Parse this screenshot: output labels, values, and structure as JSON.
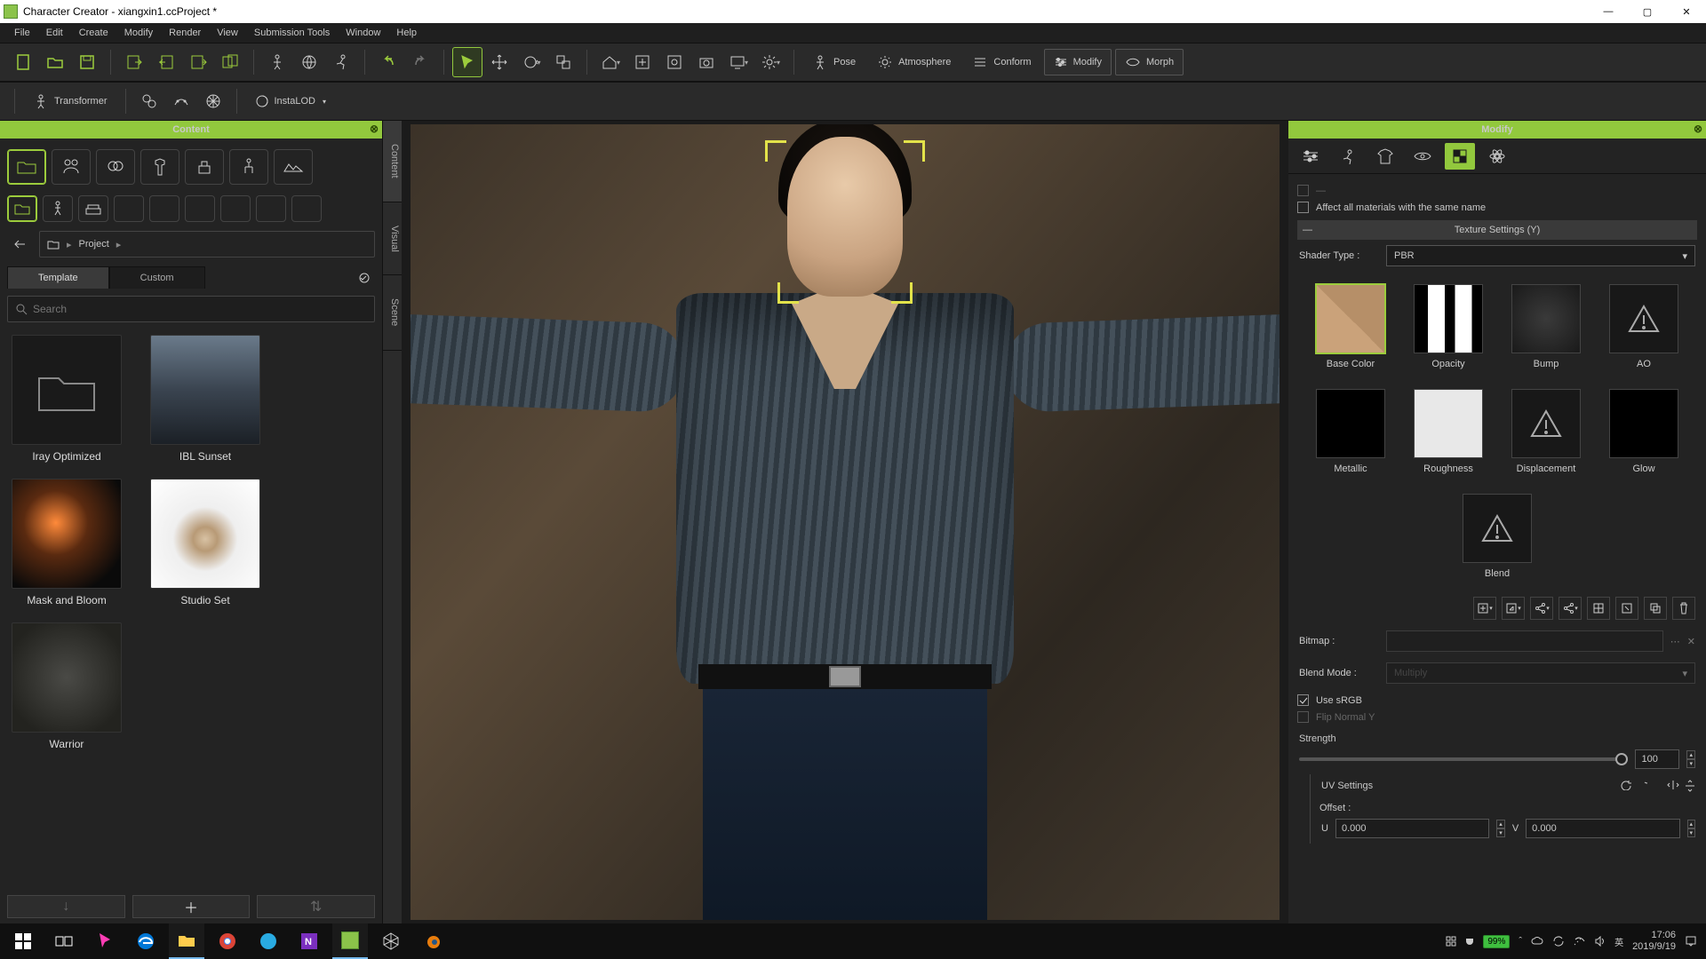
{
  "title": "Character Creator - xiangxin1.ccProject *",
  "menu": [
    "File",
    "Edit",
    "Create",
    "Modify",
    "Render",
    "View",
    "Submission Tools",
    "Window",
    "Help"
  ],
  "toolbar1_labels": {
    "pose": "Pose",
    "atmosphere": "Atmosphere",
    "conform": "Conform",
    "modify": "Modify",
    "morph": "Morph"
  },
  "toolbar2_labels": {
    "transformer": "Transformer",
    "instalod": "InstaLOD"
  },
  "left": {
    "title": "Content",
    "breadcrumb": "Project",
    "tabs": {
      "template": "Template",
      "custom": "Custom"
    },
    "search_placeholder": "Search",
    "items": [
      "Iray Optimized",
      "IBL Sunset",
      "Mask and Bloom",
      "Studio Set",
      "Warrior"
    ],
    "vtabs": [
      "Content",
      "Visual",
      "Scene"
    ]
  },
  "right": {
    "title": "Modify",
    "affect_all": "Affect all materials with the same name",
    "texture_settings": "Texture Settings  (Y)",
    "shader_label": "Shader Type :",
    "shader_value": "PBR",
    "tex": [
      "Base Color",
      "Opacity",
      "Bump",
      "AO",
      "Metallic",
      "Roughness",
      "Displacement",
      "Glow",
      "Blend"
    ],
    "bitmap": "Bitmap :",
    "blend": "Blend Mode :",
    "blend_value": "Multiply",
    "srgb": "Use sRGB",
    "flip": "Flip Normal Y",
    "strength": "Strength",
    "strength_val": "100",
    "uv": "UV Settings",
    "offset": "Offset :",
    "u": "U",
    "v": "V",
    "uv_val": "0.000"
  },
  "taskbar": {
    "battery": "99%",
    "time": "17:06",
    "date": "2019/9/19"
  }
}
